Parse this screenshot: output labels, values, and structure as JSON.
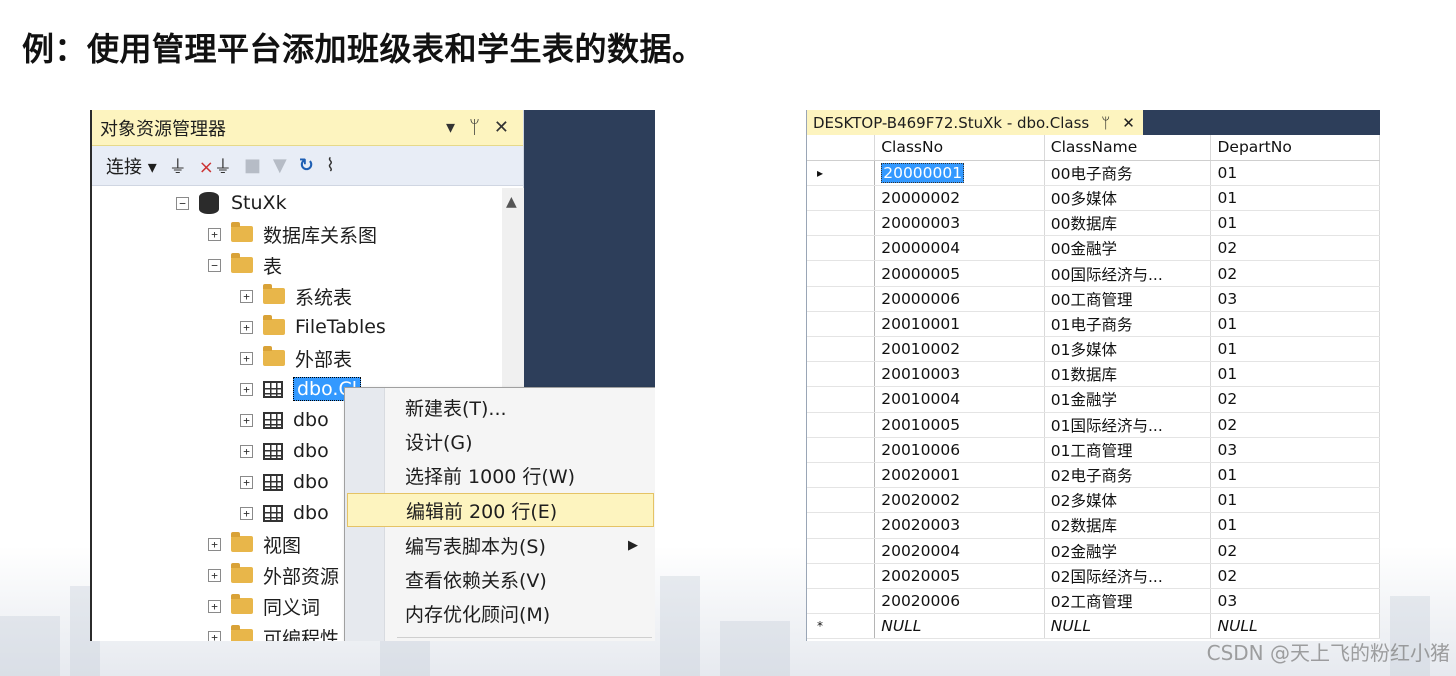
{
  "page_title": "例：使用管理平台添加班级表和学生表的数据。",
  "object_explorer": {
    "title": "对象资源管理器",
    "title_buttons": [
      "▾",
      "ᛘ",
      "✕"
    ],
    "toolbar": {
      "connect_label": "连接",
      "icons": [
        "connect-plug-icon",
        "disconnect-plug-icon",
        "stop-icon",
        "filter-icon",
        "refresh-icon",
        "activity-monitor-icon"
      ]
    },
    "tree": {
      "database": "StuXk",
      "diagrams": "数据库关系图",
      "tables": "表",
      "system_tables": "系统表",
      "file_tables": "FileTables",
      "external_tables": "外部表",
      "table_items": [
        "dbo.Cl",
        "dbo",
        "dbo",
        "dbo",
        "dbo"
      ],
      "views": "视图",
      "external_resources": "外部资源",
      "synonyms": "同义词",
      "programmability": "可编程性"
    },
    "context_menu": {
      "items": [
        "新建表(T)...",
        "设计(G)",
        "选择前 1000 行(W)",
        "编辑前 200 行(E)",
        "编写表脚本为(S)",
        "查看依赖关系(V)",
        "内存优化顾问(M)"
      ],
      "highlighted_index": 3
    }
  },
  "grid": {
    "tab_title": "DESKTOP-B469F72.StuXk - dbo.Class",
    "tab_pin": "ᛘ",
    "tab_close": "✕",
    "columns": [
      "ClassNo",
      "ClassName",
      "DepartNo"
    ],
    "rows": [
      [
        "20000001",
        "00电子商务",
        "01"
      ],
      [
        "20000002",
        "00多媒体",
        "01"
      ],
      [
        "20000003",
        "00数据库",
        "01"
      ],
      [
        "20000004",
        "00金融学",
        "02"
      ],
      [
        "20000005",
        "00国际经济与...",
        "02"
      ],
      [
        "20000006",
        "00工商管理",
        "03"
      ],
      [
        "20010001",
        "01电子商务",
        "01"
      ],
      [
        "20010002",
        "01多媒体",
        "01"
      ],
      [
        "20010003",
        "01数据库",
        "01"
      ],
      [
        "20010004",
        "01金融学",
        "02"
      ],
      [
        "20010005",
        "01国际经济与...",
        "02"
      ],
      [
        "20010006",
        "01工商管理",
        "03"
      ],
      [
        "20020001",
        "02电子商务",
        "01"
      ],
      [
        "20020002",
        "02多媒体",
        "01"
      ],
      [
        "20020003",
        "02数据库",
        "01"
      ],
      [
        "20020004",
        "02金融学",
        "02"
      ],
      [
        "20020005",
        "02国际经济与...",
        "02"
      ],
      [
        "20020006",
        "02工商管理",
        "03"
      ]
    ],
    "new_row": [
      "NULL",
      "NULL",
      "NULL"
    ],
    "current_row_marker": "▸",
    "new_row_marker": "*"
  },
  "watermark": "CSDN @天上飞的粉红小猪"
}
